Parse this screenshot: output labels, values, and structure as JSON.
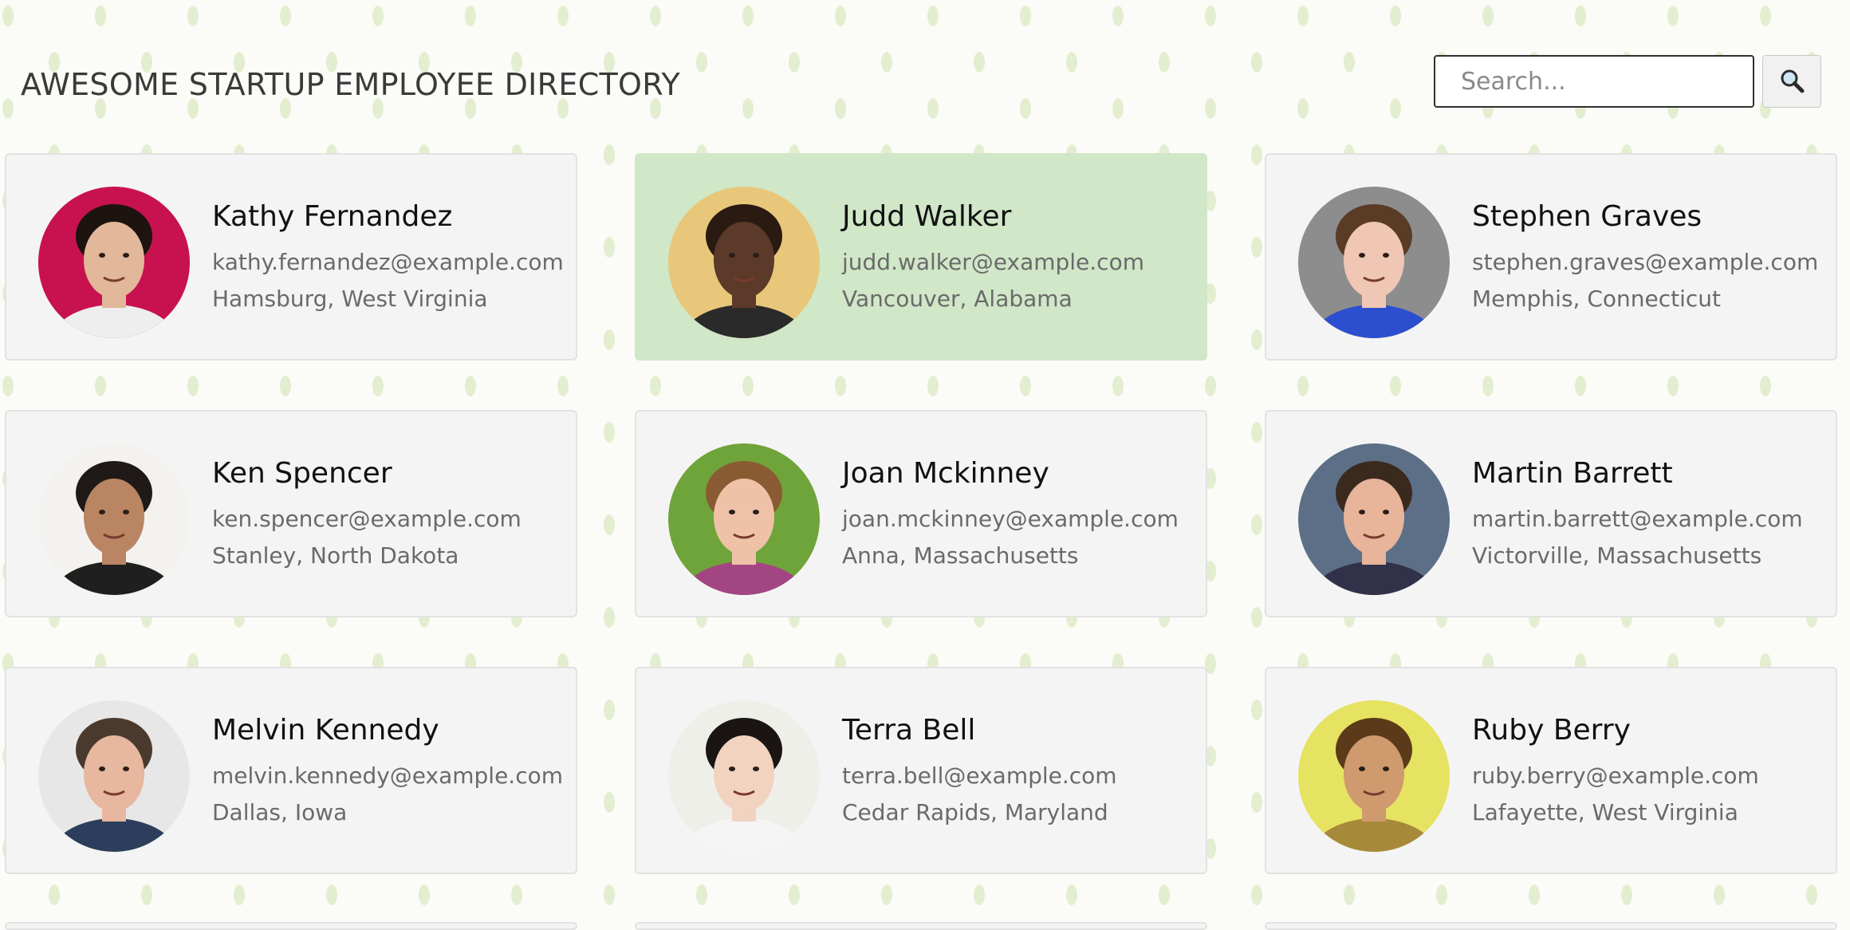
{
  "header": {
    "title": "AWESOME STARTUP EMPLOYEE DIRECTORY",
    "search": {
      "placeholder": "Search...",
      "value": ""
    },
    "search_button_icon": "search-icon"
  },
  "employees": [
    {
      "name": "Kathy Fernandez",
      "email": "kathy.fernandez@example.com",
      "location": "Hamsburg, West Virginia",
      "avatar_bg": "#c8124f",
      "skin": "#e2b79a",
      "hair": "#1d1410",
      "shirt": "#eeeeee"
    },
    {
      "name": "Judd Walker",
      "email": "judd.walker@example.com",
      "location": "Vancouver, Alabama",
      "avatar_bg": "#e9c77a",
      "skin": "#5b3a2a",
      "hair": "#2a1a12",
      "shirt": "#2a2a2a",
      "selected": true
    },
    {
      "name": "Stephen Graves",
      "email": "stephen.graves@example.com",
      "location": "Memphis, Connecticut",
      "avatar_bg": "#8d8d8d",
      "skin": "#f0c6b4",
      "hair": "#5a3b25",
      "shirt": "#2c4fd0"
    },
    {
      "name": "Ken Spencer",
      "email": "ken.spencer@example.com",
      "location": "Stanley, North Dakota",
      "avatar_bg": "#f3f2ef",
      "skin": "#b98563",
      "hair": "#1f1a17",
      "shirt": "#1f1f1f"
    },
    {
      "name": "Joan Mckinney",
      "email": "joan.mckinney@example.com",
      "location": "Anna, Massachusetts",
      "avatar_bg": "#6fa43a",
      "skin": "#efc2a8",
      "hair": "#8a5a32",
      "shirt": "#a44583"
    },
    {
      "name": "Martin Barrett",
      "email": "martin.barrett@example.com",
      "location": "Victorville, Massachusetts",
      "avatar_bg": "#5c6f86",
      "skin": "#e8b49a",
      "hair": "#3a2a1e",
      "shirt": "#31314a"
    },
    {
      "name": "Melvin Kennedy",
      "email": "melvin.kennedy@example.com",
      "location": "Dallas, Iowa",
      "avatar_bg": "#e7e7e7",
      "skin": "#e7b79f",
      "hair": "#4a3a2e",
      "shirt": "#2d3e5c"
    },
    {
      "name": "Terra Bell",
      "email": "terra.bell@example.com",
      "location": "Cedar Rapids, Maryland",
      "avatar_bg": "#efefe9",
      "skin": "#f1d3c0",
      "hair": "#1a1512",
      "shirt": "#f5f5f5"
    },
    {
      "name": "Ruby Berry",
      "email": "ruby.berry@example.com",
      "location": "Lafayette, West Virginia",
      "avatar_bg": "#e6e262",
      "skin": "#cf9a6e",
      "hair": "#5a3a18",
      "shirt": "#a68a3a"
    }
  ]
}
